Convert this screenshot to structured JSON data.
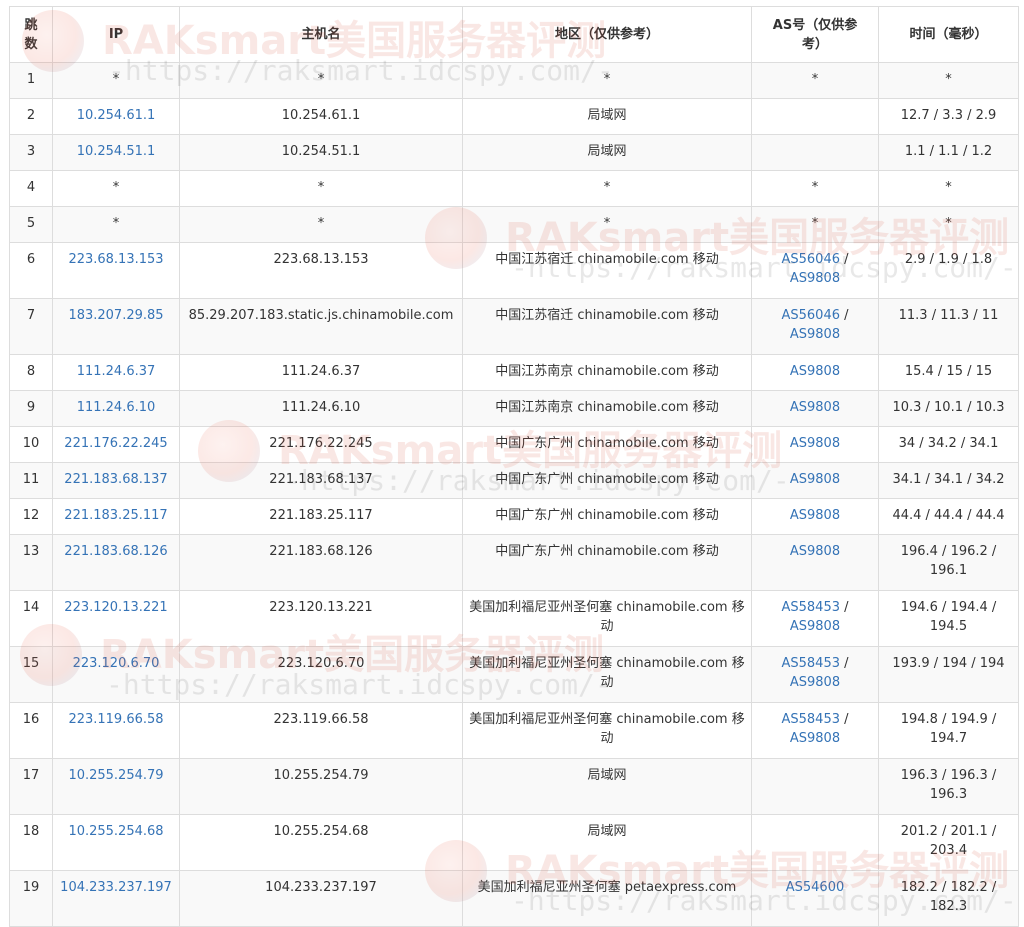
{
  "headers": [
    "跳数",
    "IP",
    "主机名",
    "地区（仅供参考）",
    "AS号（仅供参考）",
    "时间（毫秒）"
  ],
  "rows": [
    {
      "hop": "1",
      "ip": "*",
      "host": "*",
      "region": "*",
      "as": "*",
      "time": "*"
    },
    {
      "hop": "2",
      "ip": "10.254.61.1",
      "host": "10.254.61.1",
      "region": "局域网",
      "as": "",
      "time": "12.7 / 3.3 / 2.9"
    },
    {
      "hop": "3",
      "ip": "10.254.51.1",
      "host": "10.254.51.1",
      "region": "局域网",
      "as": "",
      "time": "1.1 / 1.1 / 1.2"
    },
    {
      "hop": "4",
      "ip": "*",
      "host": "*",
      "region": "*",
      "as": "*",
      "time": "*"
    },
    {
      "hop": "5",
      "ip": "*",
      "host": "*",
      "region": "*",
      "as": "*",
      "time": "*"
    },
    {
      "hop": "6",
      "ip": "223.68.13.153",
      "host": "223.68.13.153",
      "region": "中国江苏宿迁 chinamobile.com 移动",
      "as": "AS56046 / AS9808",
      "time": "2.9 / 1.9 / 1.8"
    },
    {
      "hop": "7",
      "ip": "183.207.29.85",
      "host": "85.29.207.183.static.js.chinamobile.com",
      "region": "中国江苏宿迁 chinamobile.com 移动",
      "as": "AS56046 / AS9808",
      "time": "11.3 / 11.3 / 11"
    },
    {
      "hop": "8",
      "ip": "111.24.6.37",
      "host": "111.24.6.37",
      "region": "中国江苏南京 chinamobile.com 移动",
      "as": "AS9808",
      "time": "15.4 / 15 / 15"
    },
    {
      "hop": "9",
      "ip": "111.24.6.10",
      "host": "111.24.6.10",
      "region": "中国江苏南京 chinamobile.com 移动",
      "as": "AS9808",
      "time": "10.3 / 10.1 / 10.3"
    },
    {
      "hop": "10",
      "ip": "221.176.22.245",
      "host": "221.176.22.245",
      "region": "中国广东广州 chinamobile.com 移动",
      "as": "AS9808",
      "time": "34 / 34.2 / 34.1"
    },
    {
      "hop": "11",
      "ip": "221.183.68.137",
      "host": "221.183.68.137",
      "region": "中国广东广州 chinamobile.com 移动",
      "as": "AS9808",
      "time": "34.1 / 34.1 / 34.2"
    },
    {
      "hop": "12",
      "ip": "221.183.25.117",
      "host": "221.183.25.117",
      "region": "中国广东广州 chinamobile.com 移动",
      "as": "AS9808",
      "time": "44.4 / 44.4 / 44.4"
    },
    {
      "hop": "13",
      "ip": "221.183.68.126",
      "host": "221.183.68.126",
      "region": "中国广东广州 chinamobile.com 移动",
      "as": "AS9808",
      "time": "196.4 / 196.2 / 196.1"
    },
    {
      "hop": "14",
      "ip": "223.120.13.221",
      "host": "223.120.13.221",
      "region": "美国加利福尼亚州圣何塞 chinamobile.com 移动",
      "as": "AS58453 / AS9808",
      "time": "194.6 / 194.4 / 194.5"
    },
    {
      "hop": "15",
      "ip": "223.120.6.70",
      "host": "223.120.6.70",
      "region": "美国加利福尼亚州圣何塞 chinamobile.com 移动",
      "as": "AS58453 / AS9808",
      "time": "193.9 / 194 / 194"
    },
    {
      "hop": "16",
      "ip": "223.119.66.58",
      "host": "223.119.66.58",
      "region": "美国加利福尼亚州圣何塞 chinamobile.com 移动",
      "as": "AS58453 / AS9808",
      "time": "194.8 / 194.9 / 194.7"
    },
    {
      "hop": "17",
      "ip": "10.255.254.79",
      "host": "10.255.254.79",
      "region": "局域网",
      "as": "",
      "time": "196.3 / 196.3 / 196.3"
    },
    {
      "hop": "18",
      "ip": "10.255.254.68",
      "host": "10.255.254.68",
      "region": "局域网",
      "as": "",
      "time": "201.2 / 201.1 / 203.4"
    },
    {
      "hop": "19",
      "ip": "104.233.237.197",
      "host": "104.233.237.197",
      "region": "美国加利福尼亚州圣何塞 petaexpress.com",
      "as": "AS54600",
      "time": "182.2 / 182.2 / 182.3"
    }
  ],
  "watermark": {
    "title": "RAKsmart美国服务器评测",
    "url": "-https://raksmart.idcspy.com/-"
  },
  "colors": {
    "link": "#3573b6",
    "border": "#dddddd",
    "stripe": "#f9f9f9"
  }
}
